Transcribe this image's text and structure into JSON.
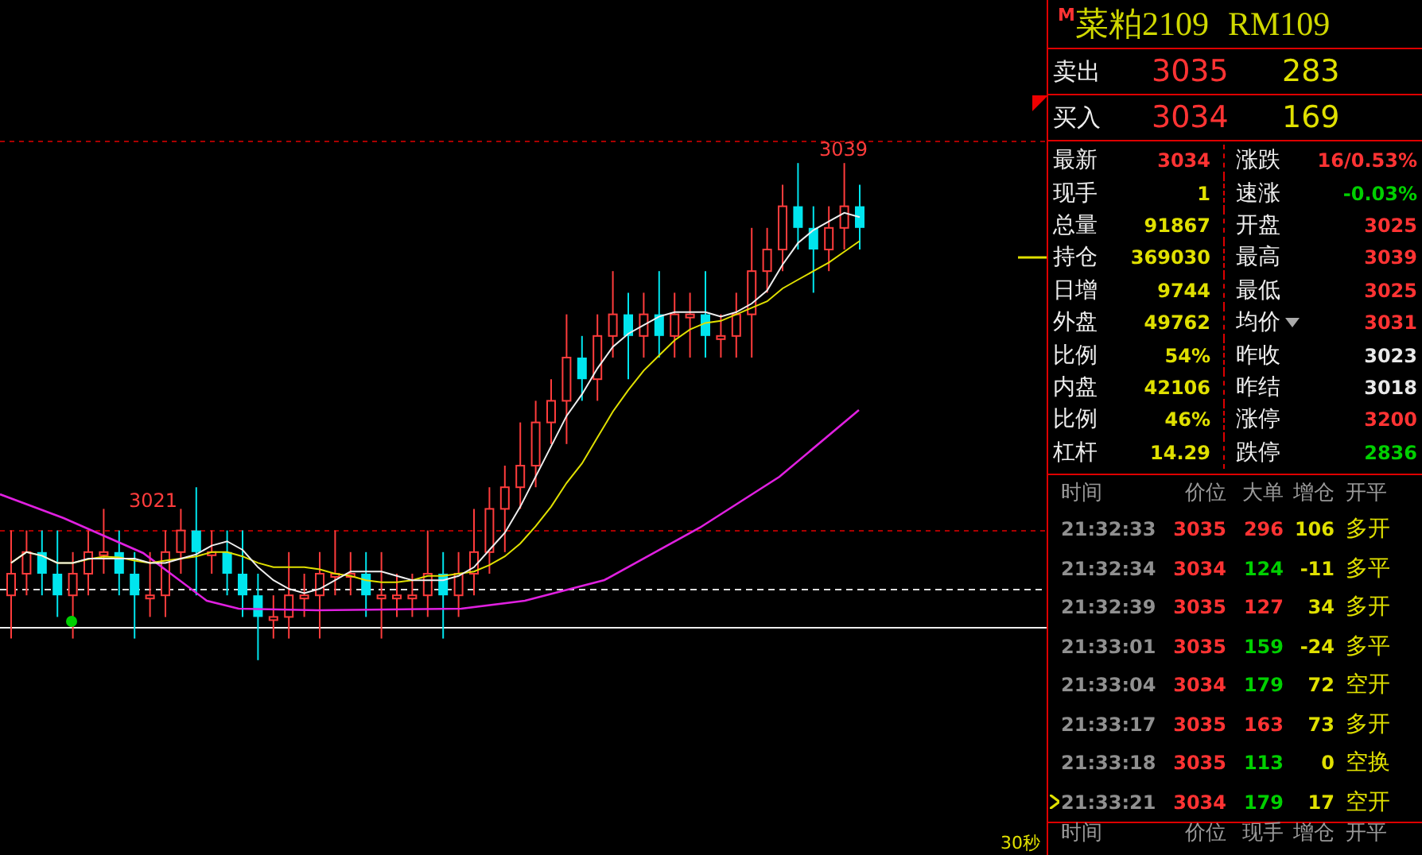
{
  "chart": {
    "high_label": "3039",
    "low_label": "3021",
    "period": "30秒"
  },
  "title": {
    "marker": "M",
    "name": "菜粕2109",
    "code": "RM109"
  },
  "quotes": [
    {
      "label": "卖出",
      "price": "3035",
      "volume": "283"
    },
    {
      "label": "买入",
      "price": "3034",
      "volume": "169"
    }
  ],
  "stats": [
    {
      "left": {
        "label": "最新",
        "value": "3034",
        "color": "#ff3333"
      },
      "right": {
        "label": "涨跌",
        "value": "16/0.53%",
        "color": "#ff3333",
        "dropdown": false
      }
    },
    {
      "left": {
        "label": "现手",
        "value": "1",
        "color": "#e0e000"
      },
      "right": {
        "label": "速涨",
        "value": "-0.03%",
        "color": "#00d000",
        "dropdown": false
      }
    },
    {
      "left": {
        "label": "总量",
        "value": "91867",
        "color": "#e0e000"
      },
      "right": {
        "label": "开盘",
        "value": "3025",
        "color": "#ff3333",
        "dropdown": false
      }
    },
    {
      "left": {
        "label": "持仓",
        "value": "369030",
        "color": "#e0e000"
      },
      "right": {
        "label": "最高",
        "value": "3039",
        "color": "#ff3333",
        "dropdown": false
      }
    },
    {
      "left": {
        "label": "日增",
        "value": "9744",
        "color": "#e0e000"
      },
      "right": {
        "label": "最低",
        "value": "3025",
        "color": "#ff3333",
        "dropdown": false
      }
    },
    {
      "left": {
        "label": "外盘",
        "value": "49762",
        "color": "#e0e000"
      },
      "right": {
        "label": "均价",
        "value": "3031",
        "color": "#ff3333",
        "dropdown": true
      }
    },
    {
      "left": {
        "label": "比例",
        "value": "54%",
        "color": "#e0e000"
      },
      "right": {
        "label": "昨收",
        "value": "3023",
        "color": "#e8e8e8",
        "dropdown": false
      }
    },
    {
      "left": {
        "label": "内盘",
        "value": "42106",
        "color": "#e0e000"
      },
      "right": {
        "label": "昨结",
        "value": "3018",
        "color": "#e8e8e8",
        "dropdown": false
      }
    },
    {
      "left": {
        "label": "比例",
        "value": "46%",
        "color": "#e0e000"
      },
      "right": {
        "label": "涨停",
        "value": "3200",
        "color": "#ff3333",
        "dropdown": false
      }
    },
    {
      "left": {
        "label": "杠杆",
        "value": "14.29",
        "color": "#e0e000"
      },
      "right": {
        "label": "跌停",
        "value": "2836",
        "color": "#00d000",
        "dropdown": false
      }
    }
  ],
  "trades": {
    "columns": [
      "时间",
      "价位",
      "大单",
      "增仓",
      "开平"
    ],
    "rows": [
      {
        "time": "21:32:33",
        "price": "3035",
        "volume": "296",
        "color": "#ff3333",
        "change": "106",
        "action": "多开",
        "selected": false
      },
      {
        "time": "21:32:34",
        "price": "3034",
        "volume": "124",
        "color": "#00d000",
        "change": "-11",
        "action": "多平",
        "selected": false
      },
      {
        "time": "21:32:39",
        "price": "3035",
        "volume": "127",
        "color": "#ff3333",
        "change": "34",
        "action": "多开",
        "selected": false
      },
      {
        "time": "21:33:01",
        "price": "3035",
        "volume": "159",
        "color": "#00d000",
        "change": "-24",
        "action": "多平",
        "selected": false
      },
      {
        "time": "21:33:04",
        "price": "3034",
        "volume": "179",
        "color": "#00d000",
        "change": "72",
        "action": "空开",
        "selected": false
      },
      {
        "time": "21:33:17",
        "price": "3035",
        "volume": "163",
        "color": "#ff3333",
        "change": "73",
        "action": "多开",
        "selected": false
      },
      {
        "time": "21:33:18",
        "price": "3035",
        "volume": "113",
        "color": "#00d000",
        "change": "0",
        "action": "空换",
        "selected": false
      },
      {
        "time": "21:33:21",
        "price": "3034",
        "volume": "179",
        "color": "#00d000",
        "change": "17",
        "action": "空开",
        "selected": true
      }
    ]
  },
  "ticks": {
    "columns": [
      "时间",
      "价位",
      "现手",
      "增仓",
      "开平"
    ]
  }
}
